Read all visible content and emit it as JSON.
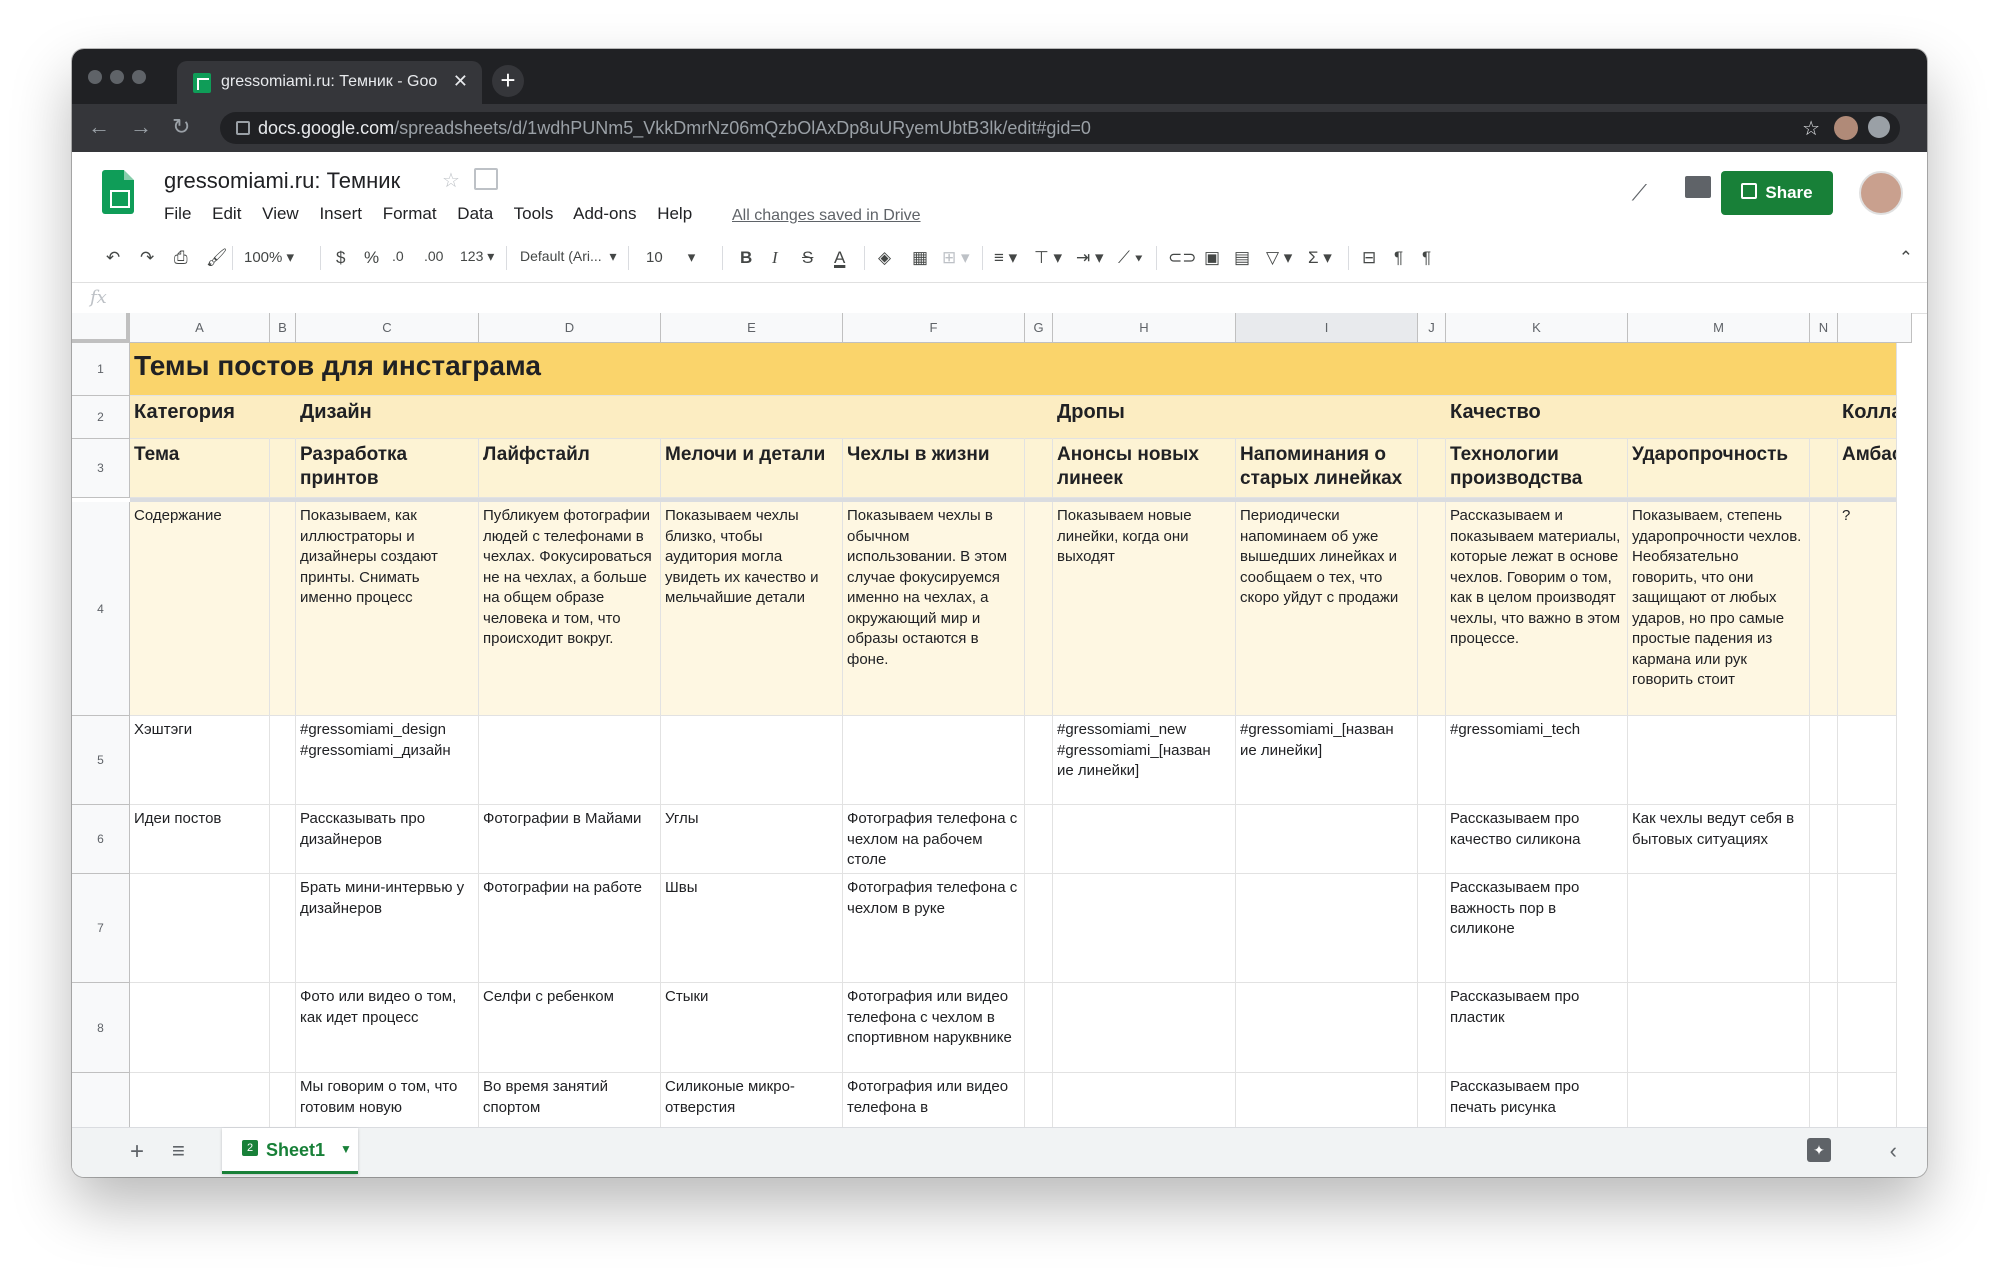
{
  "browser": {
    "tab_title": "gressomiami.ru: Темник - Goo",
    "url_host": "docs.google.com",
    "url_path": "/spreadsheets/d/1wdhPUNm5_VkkDmrNz06mQzbOlAxDp8uURyemUbtB3lk/edit#gid=0"
  },
  "doc": {
    "title": "gressomiami.ru: Темник",
    "menu": [
      "File",
      "Edit",
      "View",
      "Insert",
      "Format",
      "Data",
      "Tools",
      "Add-ons",
      "Help"
    ],
    "saved_status": "All changes saved in Drive",
    "share_label": "Share"
  },
  "toolbar": {
    "zoom": "100%",
    "currency": "$",
    "percent": "%",
    "dec_less": ".0",
    "dec_more": ".00",
    "format_more": "123",
    "font": "Default (Ari...",
    "font_size": "10"
  },
  "columns": [
    "A",
    "B",
    "C",
    "D",
    "E",
    "F",
    "G",
    "H",
    "I",
    "J",
    "K",
    "M",
    "N"
  ],
  "rows": [
    "1",
    "2",
    "3",
    "4",
    "5",
    "6",
    "7",
    "8",
    ""
  ],
  "cells": {
    "r1": {
      "A": "Темы постов для инстаграма"
    },
    "r2": {
      "A": "Категория",
      "C": "Дизайн",
      "H": "Дропы",
      "K": "Качество",
      "O": "Колла"
    },
    "r3": {
      "A": "Тема",
      "C": "Разработка принтов",
      "D": "Лайфстайл",
      "E": "Мелочи и детали",
      "F": "Чехлы в жизни",
      "H": "Анонсы новых линеек",
      "I": "Напоминания о старых линейках",
      "K": "Технологии производства",
      "M": "Ударопрочность",
      "O": "Амбас"
    },
    "r4": {
      "A": "Содержание",
      "C": "Показываем, как иллюстраторы и дизайнеры создают принты. Снимать именно процесс",
      "D": "Публикуем фотографии людей с телефонами в чехлах. Фокусироваться не на чехлах, а больше на общем образе человека и том, что происходит вокруг.",
      "E": "Показываем чехлы близко, чтобы аудитория могла увидеть их качество и мельчайшие детали",
      "F": "Показываем чехлы в обычном использовании. В этом случае фокусируемся именно на чехлах, а окружающий мир и образы остаются в фоне.",
      "H": "Показываем новые линейки, когда они выходят",
      "I": "Периодически напоминаем об уже вышедших линейках и сообщаем о тех, что скоро уйдут с продажи",
      "K": "Рассказываем и показываем материалы, которые лежат в основе чехлов. Говорим о том, как в целом производят чехлы, что важно в этом процессе.",
      "M": "Показываем, степень ударопрочности чехлов. Необязательно говорить, что они защищают от любых ударов, но про самые простые падения из кармана или рук говорить стоит",
      "O": "?"
    },
    "r5": {
      "A": "Хэштэги",
      "C": "#gressomiami_design #gressomiami_дизайн",
      "H": "#gressomiami_new #gressomiami_[назван ие линейки]",
      "I": "#gressomiami_[назван ие линейки]",
      "K": "#gressomiami_tech"
    },
    "r6": {
      "A": "Идеи постов",
      "C": "Рассказывать про дизайнеров",
      "D": "Фотографии в Майами",
      "E": "Углы",
      "F": "Фотография телефона с чехлом на рабочем столе",
      "K": "Рассказываем про качество силикона",
      "M": "Как чехлы ведут себя в бытовых ситуациях"
    },
    "r7": {
      "C": "Брать мини-интервью у дизайнеров",
      "D": "Фотографии на работе",
      "E": "Швы",
      "F": "Фотография телефона с чехлом в руке",
      "K": "Рассказываем про важность пор в силиконе"
    },
    "r8": {
      "C": "Фото или видео о том, как идет процесс",
      "D": "Селфи с ребенком",
      "E": "Стыки",
      "F": "Фотография или видео телефона с чехлом в спортивном наруквнике",
      "K": "Рассказываем про пластик"
    },
    "r9": {
      "C": "Мы говорим о том, что готовим новую",
      "D": "Во время занятий спортом",
      "E": "Силиконые микро-отверстия",
      "F": "Фотография или видео телефона в",
      "K": "Рассказываем про печать рисунка"
    }
  },
  "sheet_tab": {
    "icon_text": "2",
    "label": "Sheet1"
  },
  "colors": {
    "accent_green": "#188038",
    "header_yellow": "#fad46b",
    "light_yellow": "#fcedc2"
  }
}
